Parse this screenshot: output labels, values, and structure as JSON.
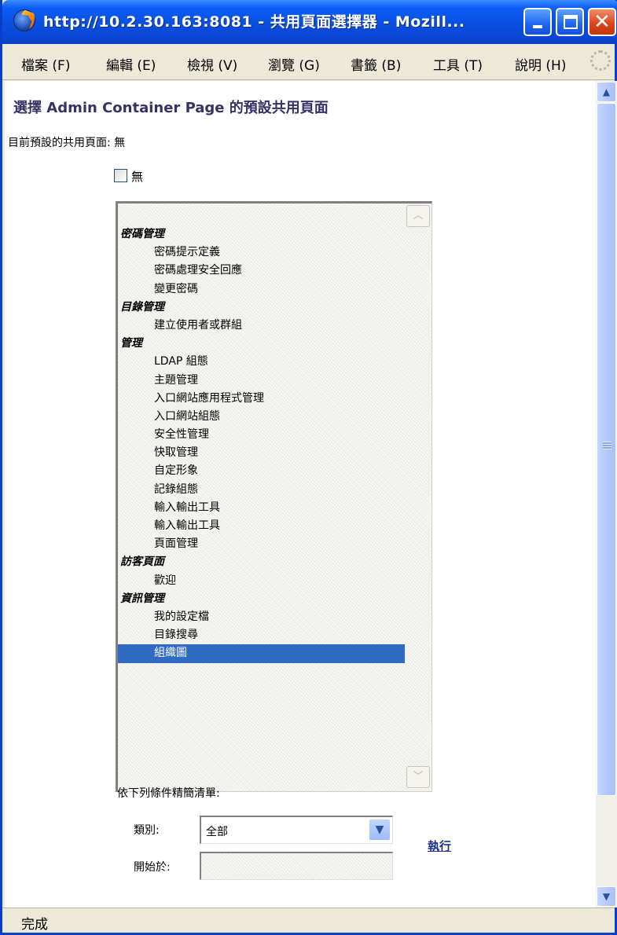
{
  "window": {
    "title": "http://10.2.30.163:8081 - 共用頁面選擇器 - Mozill..."
  },
  "menubar": {
    "items": [
      {
        "label": "檔案 (F)"
      },
      {
        "label": "編輯 (E)"
      },
      {
        "label": "檢視 (V)"
      },
      {
        "label": "瀏覽 (G)"
      },
      {
        "label": "書籤 (B)"
      },
      {
        "label": "工具 (T)"
      },
      {
        "label": "說明 (H)"
      }
    ]
  },
  "page": {
    "heading": "選擇 Admin Container Page 的預設共用頁面",
    "current_default": "目前預設的共用頁面: 無",
    "none_checkbox_label": "無"
  },
  "listbox": {
    "rows": [
      {
        "kind": "group",
        "label": "密碼管理"
      },
      {
        "kind": "item",
        "label": "密碼提示定義"
      },
      {
        "kind": "item",
        "label": "密碼處理安全回應"
      },
      {
        "kind": "item",
        "label": "變更密碼"
      },
      {
        "kind": "group",
        "label": "目錄管理"
      },
      {
        "kind": "item",
        "label": "建立使用者或群組"
      },
      {
        "kind": "group",
        "label": "管理"
      },
      {
        "kind": "item",
        "label": "LDAP 組態"
      },
      {
        "kind": "item",
        "label": "主題管理"
      },
      {
        "kind": "item",
        "label": "入口網站應用程式管理"
      },
      {
        "kind": "item",
        "label": "入口網站組態"
      },
      {
        "kind": "item",
        "label": "安全性管理"
      },
      {
        "kind": "item",
        "label": "快取管理"
      },
      {
        "kind": "item",
        "label": "自定形象"
      },
      {
        "kind": "item",
        "label": "記錄組態"
      },
      {
        "kind": "item",
        "label": "輸入輸出工具"
      },
      {
        "kind": "item",
        "label": "輸入輸出工具"
      },
      {
        "kind": "item",
        "label": "頁面管理"
      },
      {
        "kind": "group",
        "label": "訪客頁面"
      },
      {
        "kind": "item",
        "label": "歡迎"
      },
      {
        "kind": "group",
        "label": "資訊管理"
      },
      {
        "kind": "item",
        "label": "我的設定檔"
      },
      {
        "kind": "item",
        "label": "目錄搜尋"
      },
      {
        "kind": "item",
        "label": "組織圖",
        "selected": true
      }
    ]
  },
  "filter": {
    "heading": "依下列條件精簡清單:",
    "category_label": "類別:",
    "category_value": "全部",
    "start_label": "開始於:",
    "start_value": "",
    "execute_link": "執行"
  },
  "statusbar": {
    "text": "完成"
  },
  "icons": {
    "app": "firefox-icon",
    "throbber": "throbber-icon"
  },
  "colors": {
    "titlebar": "#0a4fe0",
    "selection": "#316ac5",
    "heading": "#333366",
    "link": "#1b2f8d"
  }
}
